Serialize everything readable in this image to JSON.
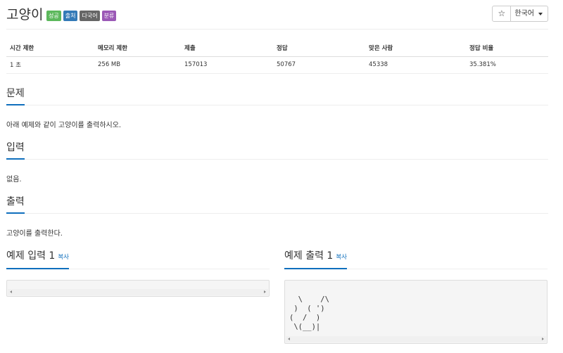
{
  "problem": {
    "title": "고양이",
    "badges": [
      {
        "label": "성공",
        "color": "#5cb85c"
      },
      {
        "label": "출처",
        "color": "#337ab7"
      },
      {
        "label": "다국어",
        "color": "#666666"
      },
      {
        "label": "분류",
        "color": "#9b59b6"
      }
    ]
  },
  "toolbar": {
    "star_icon": "☆",
    "language": "한국어"
  },
  "info_table": {
    "headers": [
      "시간 제한",
      "메모리 제한",
      "제출",
      "정답",
      "맞은 사람",
      "정답 비율"
    ],
    "row": [
      "1 초",
      "256 MB",
      "157013",
      "50767",
      "45338",
      "35.381%"
    ]
  },
  "sections": {
    "problem": {
      "heading": "문제",
      "text": "아래 예제와 같이 고양이를 출력하시오."
    },
    "input": {
      "heading": "입력",
      "text": "없음."
    },
    "output": {
      "heading": "출력",
      "text": "고양이를 출력한다."
    }
  },
  "samples": {
    "input": {
      "heading": "예제 입력 1",
      "copy": "복사",
      "content": ""
    },
    "output": {
      "heading": "예제 출력 1",
      "copy": "복사",
      "content": "\\    /\\\n )  ( ')\n(  /  )\n \\(__)|"
    }
  }
}
